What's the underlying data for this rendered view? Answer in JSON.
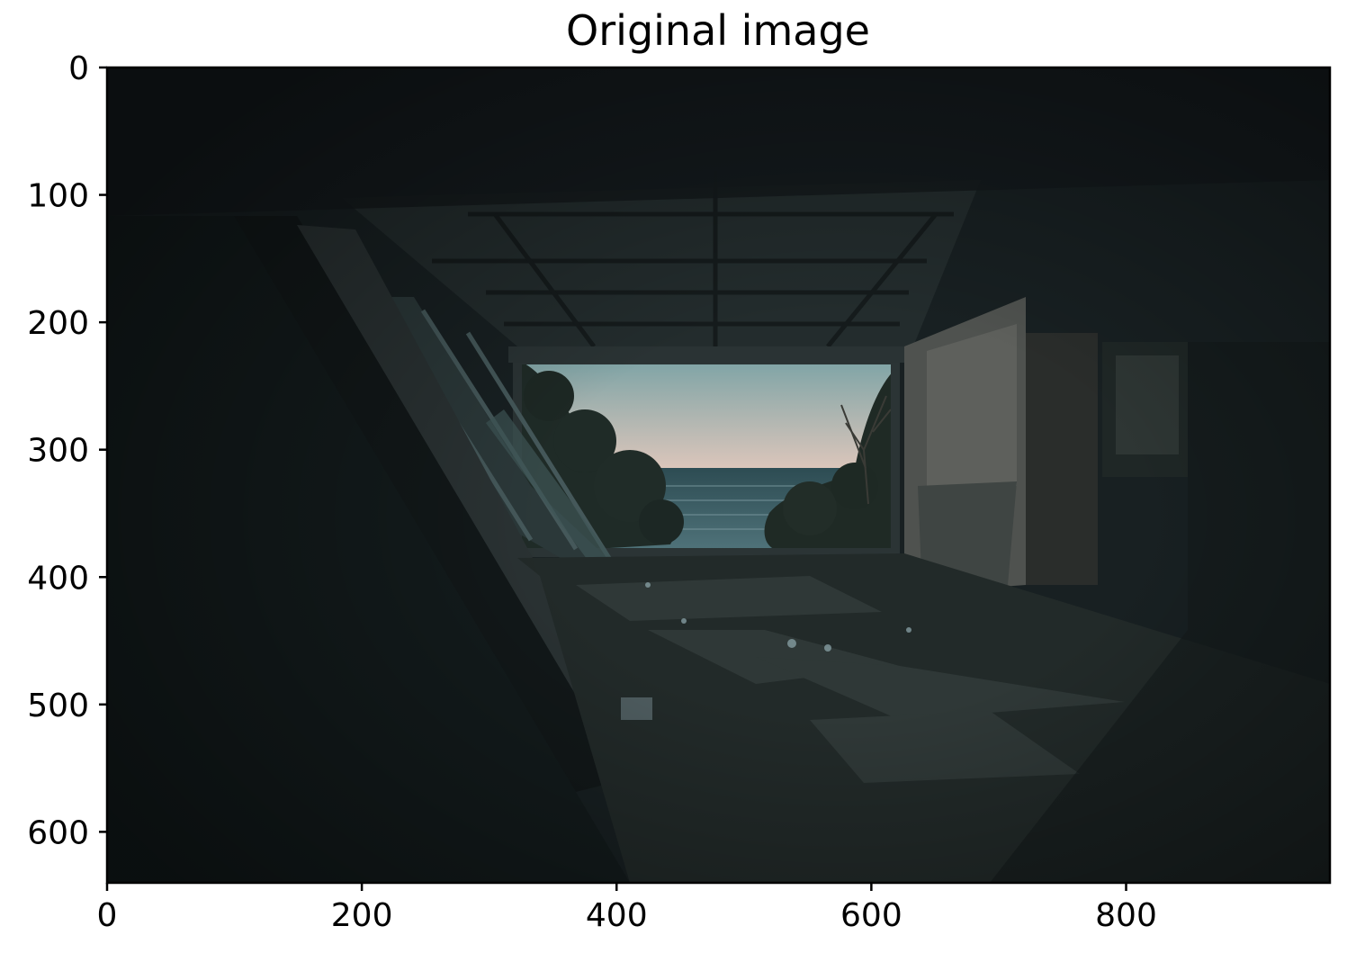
{
  "figure": {
    "title": "Original image"
  },
  "chart_data": {
    "type": "image",
    "title": "Original image",
    "xlabel": "",
    "ylabel": "",
    "xlim": [
      0,
      960
    ],
    "ylim": [
      640,
      0
    ],
    "grid": false,
    "x_ticks": [
      {
        "value": 0,
        "label": "0"
      },
      {
        "value": 200,
        "label": "200"
      },
      {
        "value": 400,
        "label": "400"
      },
      {
        "value": 600,
        "label": "600"
      },
      {
        "value": 800,
        "label": "800"
      }
    ],
    "y_ticks": [
      {
        "value": 0,
        "label": "0"
      },
      {
        "value": 100,
        "label": "100"
      },
      {
        "value": 200,
        "label": "200"
      },
      {
        "value": 300,
        "label": "300"
      },
      {
        "value": 400,
        "label": "400"
      },
      {
        "value": 500,
        "label": "500"
      },
      {
        "value": 600,
        "label": "600"
      }
    ]
  },
  "image": {
    "palette": {
      "interior_dark": "#182022",
      "ceiling": "#222b2c",
      "sky_top": "#7fa4a6",
      "sky_horizon": "#dcc6bb",
      "sea": "#3c5f66",
      "foliage": "#1e2a26",
      "wall_light": "#5b5e5a",
      "debris": "#2c3433",
      "glint": "#8aa3a8"
    }
  }
}
